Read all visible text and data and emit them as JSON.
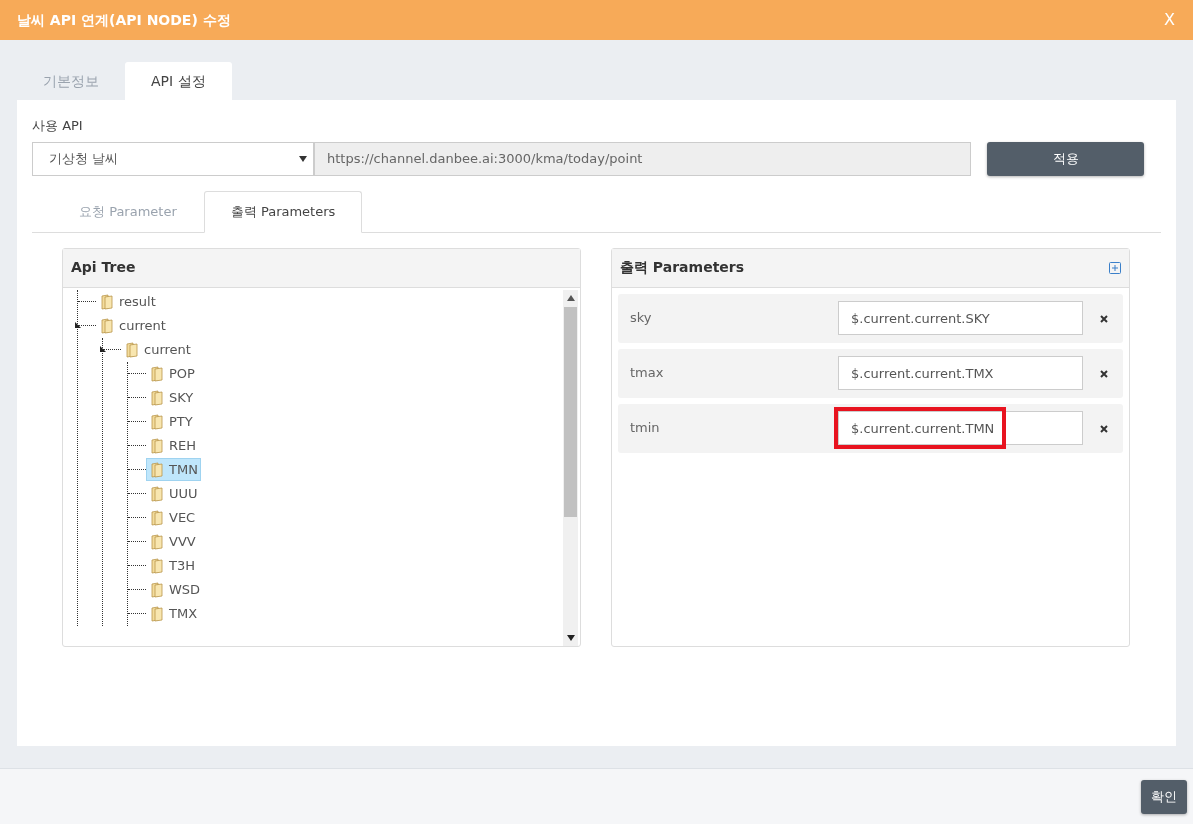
{
  "dialog": {
    "title": "날씨 API 연계(API NODE) 수정",
    "close": "X"
  },
  "tabs": [
    {
      "label": "기본정보",
      "selected": false
    },
    {
      "label": "API 설정",
      "selected": true
    }
  ],
  "api": {
    "label": "사용 API",
    "select_value": "기상청 날씨",
    "url": "https://channel.danbee.ai:3000/kma/today/point",
    "apply": "적용"
  },
  "sub_tabs": [
    {
      "label": "요청 Parameter",
      "selected": false
    },
    {
      "label": "출력 Parameters",
      "selected": true
    }
  ],
  "api_tree": {
    "title": "Api Tree",
    "nodes": [
      {
        "label": "result",
        "expanded": false,
        "selected": false
      },
      {
        "label": "current",
        "expanded": true,
        "selected": false,
        "children": [
          {
            "label": "current",
            "expanded": true,
            "selected": false,
            "children": [
              {
                "label": "POP",
                "expanded": false,
                "selected": false
              },
              {
                "label": "SKY",
                "expanded": false,
                "selected": false
              },
              {
                "label": "PTY",
                "expanded": false,
                "selected": false
              },
              {
                "label": "REH",
                "expanded": false,
                "selected": false
              },
              {
                "label": "TMN",
                "expanded": false,
                "selected": true
              },
              {
                "label": "UUU",
                "expanded": false,
                "selected": false
              },
              {
                "label": "VEC",
                "expanded": false,
                "selected": false
              },
              {
                "label": "VVV",
                "expanded": false,
                "selected": false
              },
              {
                "label": "T3H",
                "expanded": false,
                "selected": false
              },
              {
                "label": "WSD",
                "expanded": false,
                "selected": false
              },
              {
                "label": "TMX",
                "expanded": false,
                "selected": false
              }
            ]
          }
        ]
      }
    ]
  },
  "output_params": {
    "title": "출력 Parameters",
    "rows": [
      {
        "name": "sky",
        "value": "$.current.current.SKY",
        "highlighted": false
      },
      {
        "name": "tmax",
        "value": "$.current.current.TMX",
        "highlighted": false
      },
      {
        "name": "tmin",
        "value": "$.current.current.TMN",
        "highlighted": true
      }
    ]
  },
  "footer": {
    "confirm": "확인"
  }
}
